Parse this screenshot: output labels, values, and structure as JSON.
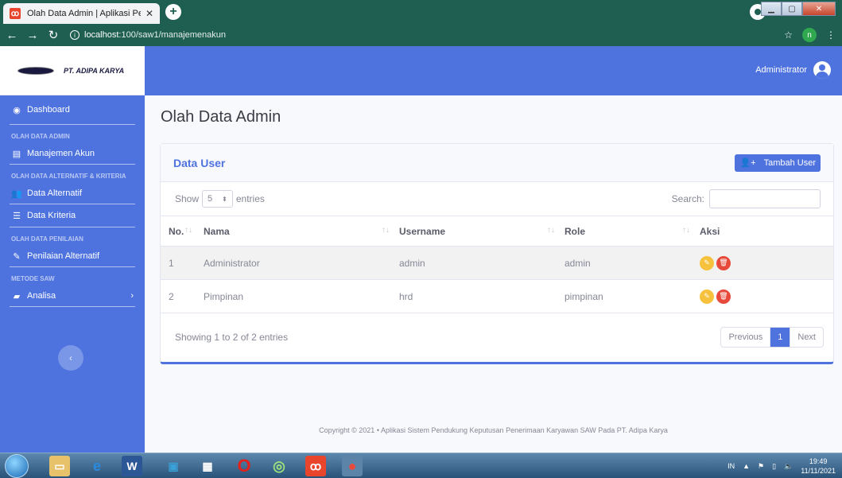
{
  "browser": {
    "tab_title": "Olah Data Admin | Aplikasi Pener",
    "tab_close": "✕",
    "new_tab": "+",
    "url_host": "localhost",
    "url_path": ":100/saw1/manajemenakun",
    "profile_initial": "n"
  },
  "brand": {
    "name": "PT. ADIPA KARYA"
  },
  "sidebar": {
    "dashboard": "Dashboard",
    "heading_admin": "OLAH DATA ADMIN",
    "manajemen_akun": "Manajemen Akun",
    "heading_alternatif": "OLAH DATA ALTERNATIF & KRITERIA",
    "data_alternatif": "Data Alternatif",
    "data_kriteria": "Data Kriteria",
    "heading_penilaian": "OLAH DATA PENILAIAN",
    "penilaian_alternatif": "Penilaian Alternatif",
    "heading_saw": "METODE SAW",
    "analisa": "Analisa"
  },
  "topbar": {
    "user": "Administrator"
  },
  "page": {
    "title": "Olah Data Admin"
  },
  "card": {
    "title": "Data User",
    "add_button": "Tambah User",
    "show_label": "Show",
    "entries_value": "5",
    "entries_label": "entries",
    "search_label": "Search:",
    "columns": [
      "No.",
      "Nama",
      "Username",
      "Role",
      "Aksi"
    ],
    "rows": [
      {
        "no": "1",
        "nama": "Administrator",
        "username": "admin",
        "role": "admin"
      },
      {
        "no": "2",
        "nama": "Pimpinan",
        "username": "hrd",
        "role": "pimpinan"
      }
    ],
    "showing": "Showing 1 to 2 of 2 entries",
    "prev": "Previous",
    "page": "1",
    "next": "Next"
  },
  "footer": {
    "copyright": "Copyright © 2021 • Aplikasi Sistem Pendukung Keputusan Penerimaan Karyawan SAW Pada PT. Adipa Karya"
  },
  "taskbar": {
    "lang": "IN",
    "time": "19:49",
    "date": "11/11/2021"
  },
  "colors": {
    "primary": "#4e73df",
    "warning": "#f6c23e",
    "danger": "#e74a3b",
    "chrome": "#1f5f52"
  }
}
